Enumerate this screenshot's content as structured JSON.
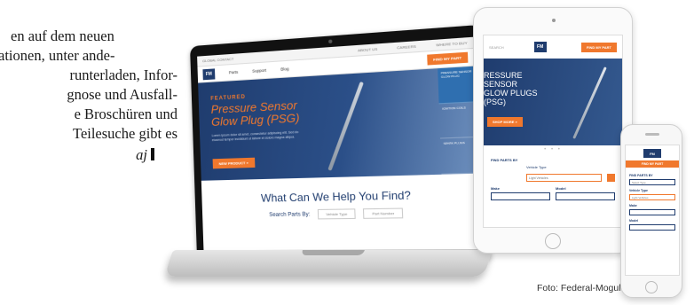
{
  "article": {
    "lines": [
      "en auf dem neuen",
      "ationen, unter ande-",
      "runterladen, Infor-",
      "gnose und Ausfall-",
      "e Broschüren und",
      "Teilesuche gibt es"
    ],
    "author": "aj"
  },
  "laptop_site": {
    "top_links": [
      "GLOBAL CONTACT",
      "ABOUT US",
      "CAREERS",
      "WHERE TO BUY"
    ],
    "logo": "FM",
    "nav": [
      "Parts",
      "Support",
      "Blog"
    ],
    "cta": "FIND MY PART",
    "featured": "FEATURED",
    "hero_title_line1": "Pressure Sensor",
    "hero_title_line2": "Glow Plug (PSG)",
    "hero_copy": "Lorem ipsum dolor sit amet, consectetur adipiscing elit. Sed do eiusmod tempor incididunt ut labore et dolore magna aliqua.",
    "hero_button": "NEW PRODUCT »",
    "side_items": [
      "PRESSURE SENSOR GLOW PLUG",
      "IGNITION COILS",
      "SPARK PLUGS"
    ],
    "help_heading": "What Can We Help You Find?",
    "search_by": "Search Parts By:",
    "search_option_1": "Vehicle Type",
    "search_option_2": "Part Number"
  },
  "tablet_site": {
    "search": "SEARCH",
    "logo": "FM",
    "cta": "FIND MY PART",
    "hero_title_line1": "RESSURE",
    "hero_title_line2": "SENSOR",
    "hero_title_line3": "GLOW PLUGS",
    "hero_title_line4": "(PSG)",
    "hero_button": "SHOP MORE »",
    "dots": "• • •",
    "find_parts": "FIND PARTS BY",
    "vehicle_type": "Vehicle Type",
    "vehicle_value": "Light Vehicles",
    "make": "Make",
    "model": "Model"
  },
  "phone_site": {
    "logo": "FM",
    "cta": "FIND MY PART",
    "find_parts": "FIND PARTS BY",
    "select_type": "Select Type",
    "vehicle_type": "Vehicle Type",
    "vehicle_value": "Light Vehicles",
    "make": "Make",
    "model": "Model"
  },
  "photo_credit": "Foto: Federal-Mogul",
  "colors": {
    "navy": "#1f3c6e",
    "orange": "#f0782d"
  }
}
